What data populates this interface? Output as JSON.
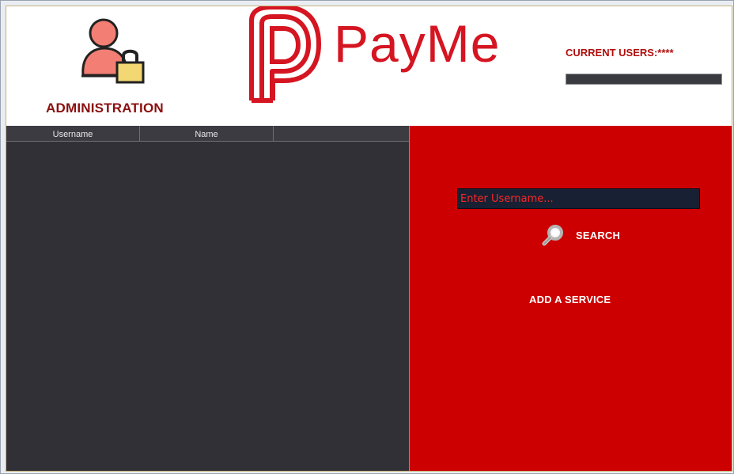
{
  "header": {
    "admin_label": "ADMINISTRATION",
    "brand_name": "PayMe",
    "current_users_label": "CURRENT USERS:****"
  },
  "table": {
    "columns": [
      "Username",
      "Name",
      ""
    ]
  },
  "search": {
    "placeholder": "Enter Username...",
    "button_label": "SEARCH"
  },
  "actions": {
    "add_service_label": "ADD A SERVICE"
  },
  "icons": {
    "admin": "admin-user-lock-icon",
    "logo": "payme-logo-icon",
    "search": "magnifier-icon"
  },
  "colors": {
    "brand_red": "#d51521",
    "panel_red": "#cc0000",
    "dark_table": "#313036",
    "admin_text": "#8b0f0f",
    "input_bg": "#172133"
  }
}
